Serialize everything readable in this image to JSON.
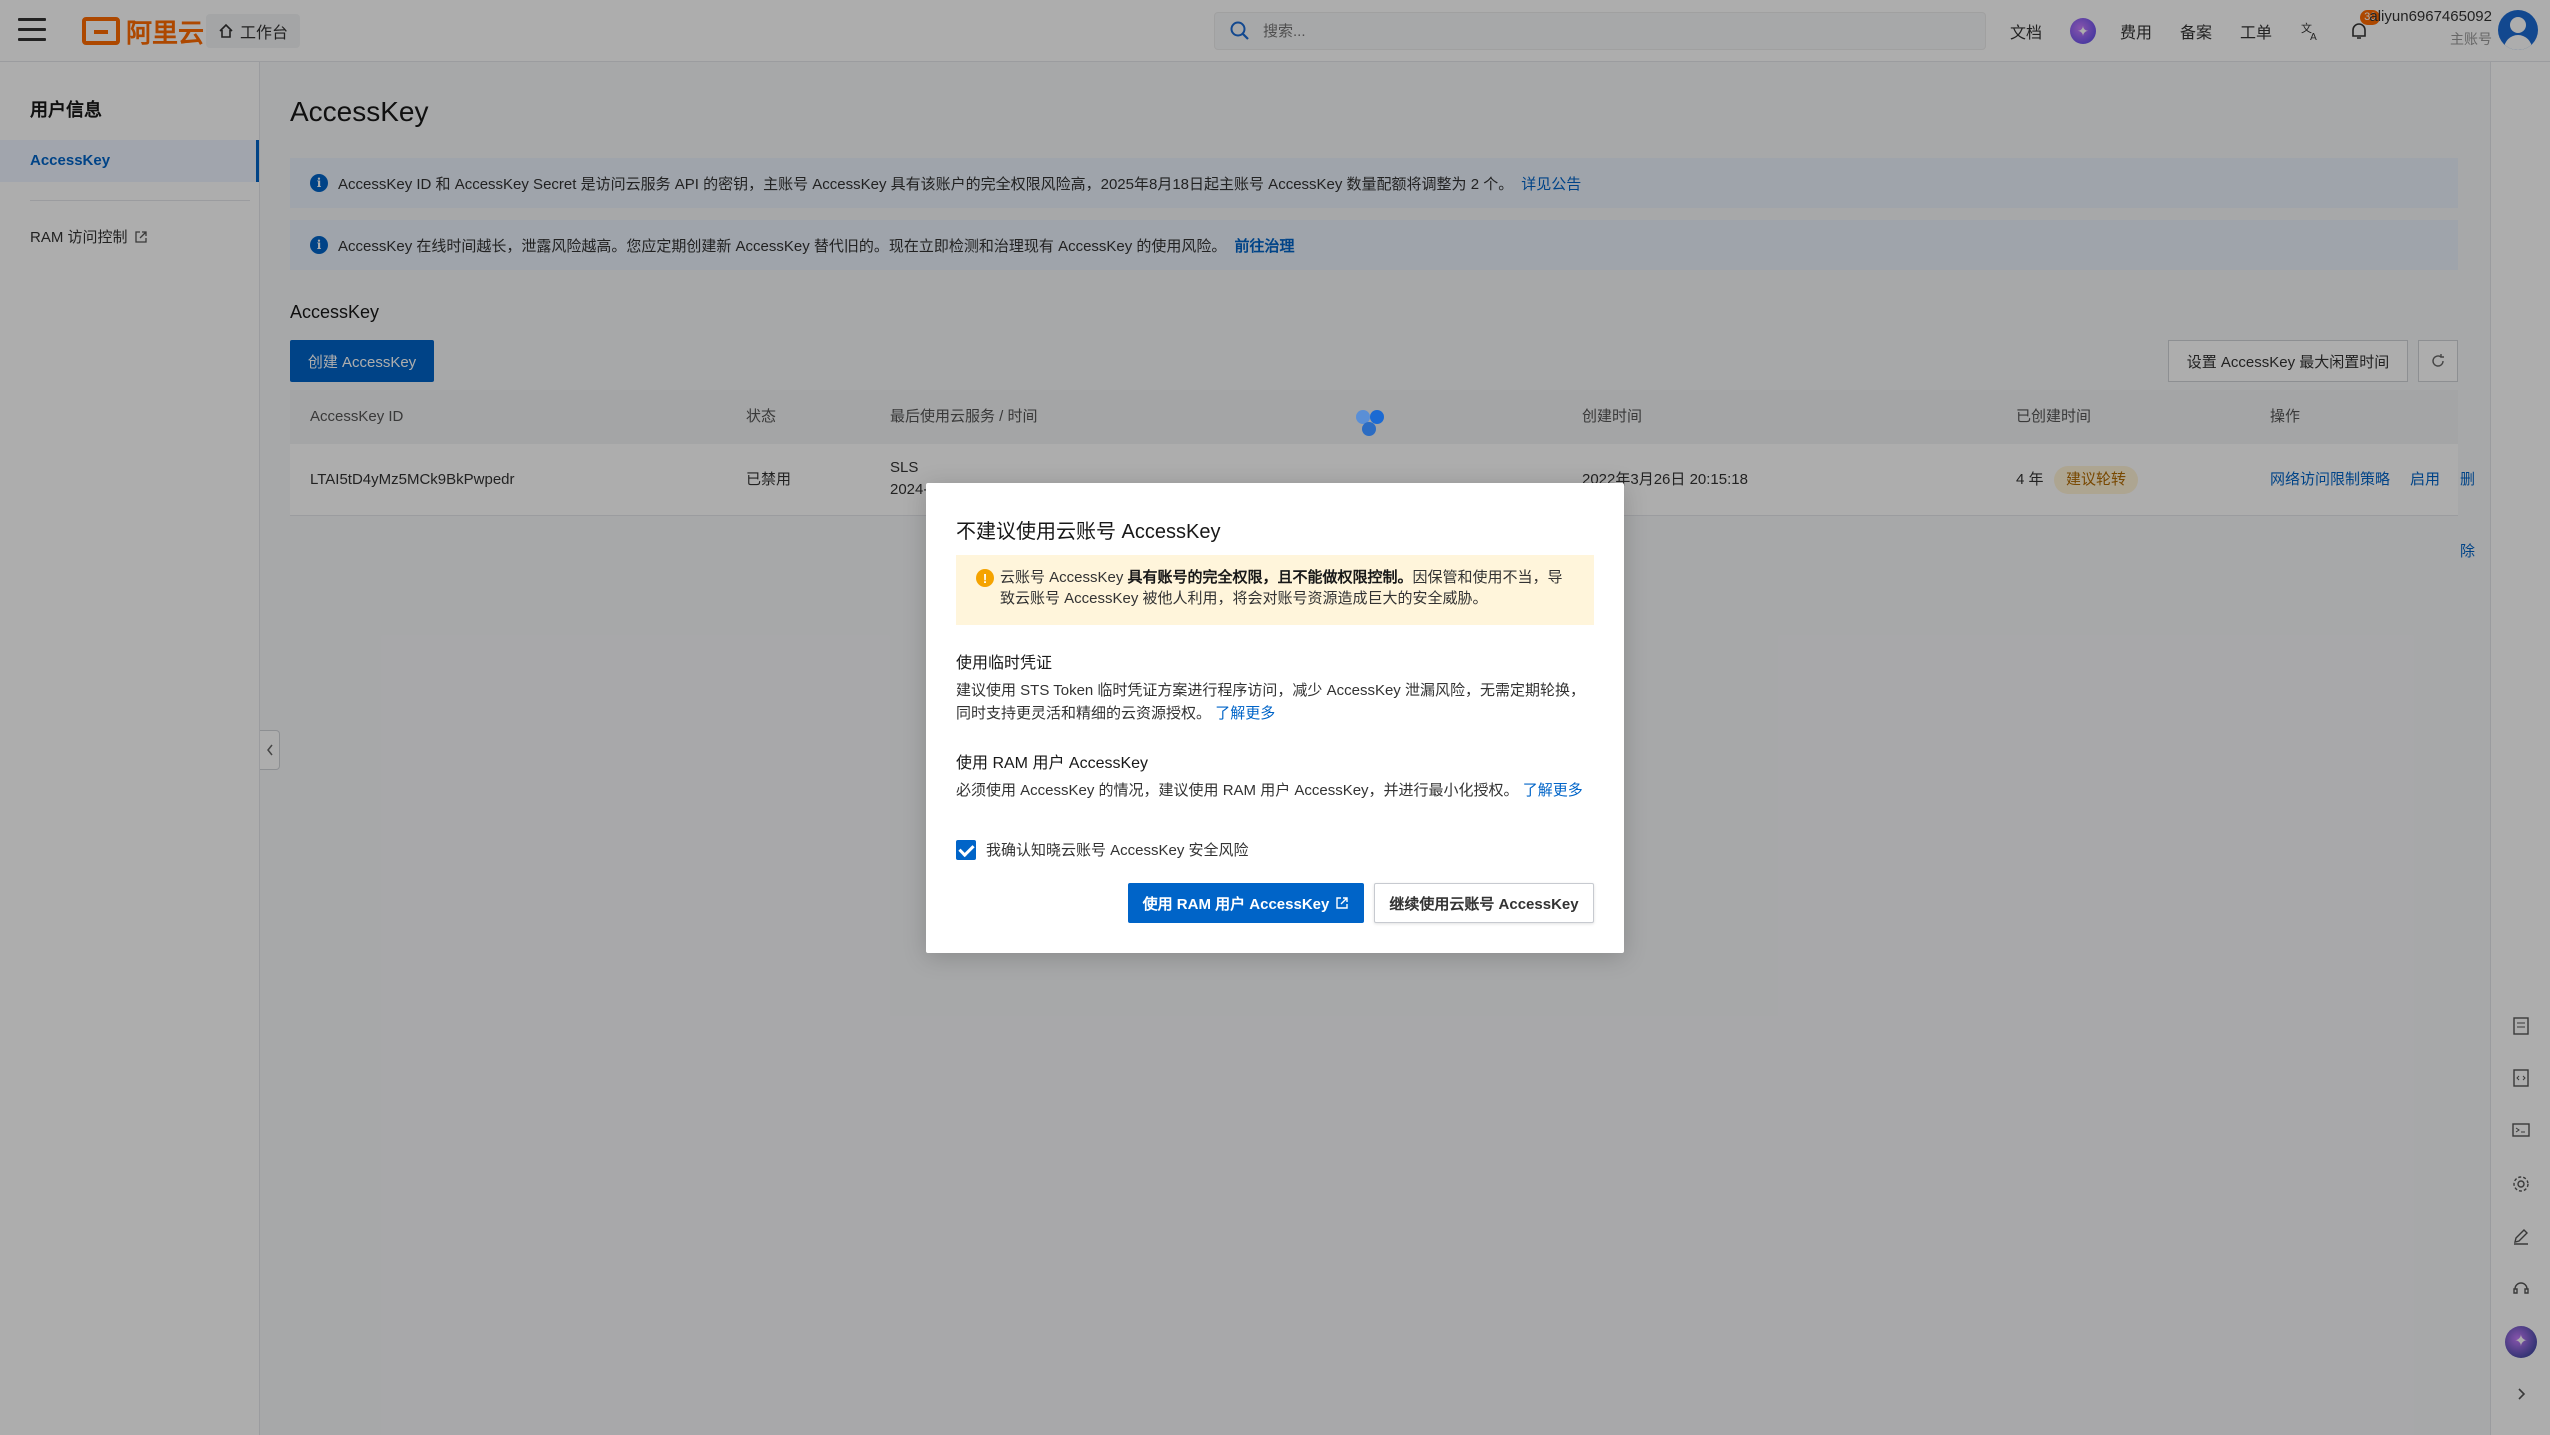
{
  "topbar": {
    "logo_text": "阿里云",
    "workbench_label": "工作台",
    "search_placeholder": "搜索...",
    "links": [
      "文档",
      "费用",
      "备案",
      "工单"
    ],
    "notification_count": "30",
    "account_name": "aliyun6967465092",
    "account_role": "主账号"
  },
  "sidebar": {
    "title": "用户信息",
    "items": [
      {
        "label": "AccessKey"
      },
      {
        "label": "RAM 访问控制"
      }
    ]
  },
  "main": {
    "page_title": "AccessKey",
    "notice1": {
      "text": "AccessKey ID 和 AccessKey Secret 是访问云服务 API 的密钥，主账号 AccessKey 具有该账户的完全权限风险高，2025年8月18日起主账号 AccessKey 数量配额将调整为 2 个。",
      "link": "详见公告"
    },
    "notice2": {
      "text": "AccessKey 在线时间越长，泄露风险越高。您应定期创建新 AccessKey 替代旧的。现在立即检测和治理现有 AccessKey 的使用风险。",
      "link": "前往治理"
    },
    "section_title": "AccessKey",
    "create_button": "创建 AccessKey",
    "max_idle_button": "设置 AccessKey 最大闲置时间",
    "table": {
      "headers": [
        "AccessKey ID",
        "状态",
        "最后使用云服务 / 时间",
        "创建时间",
        "已创建时间",
        "操作"
      ],
      "rows": [
        {
          "id": "LTAI5tD4yMz5MCk9BkPwpedr",
          "status": "已禁用",
          "service": "SLS",
          "service_time": "2024-",
          "created": "2022年3月26日 20:15:18",
          "age": "4 年",
          "badge": "建议轮转",
          "actions": [
            "网络访问限制策略",
            "启用",
            "删除"
          ]
        }
      ]
    }
  },
  "modal": {
    "title": "不建议使用云账号 AccessKey",
    "warning_prefix": "云账号 AccessKey ",
    "warning_bold": "具有账号的完全权限，且不能做权限控制。",
    "warning_suffix": "因保管和使用不当，导致云账号 AccessKey 被他人利用，将会对账号资源造成巨大的安全威胁。",
    "section1_title": "使用临时凭证",
    "section1_text": "建议使用 STS Token 临时凭证方案进行程序访问，减少 AccessKey 泄漏风险，无需定期轮换，同时支持更灵活和精细的云资源授权。",
    "section1_link": "了解更多",
    "section2_title": "使用 RAM 用户 AccessKey",
    "section2_text": "必须使用 AccessKey 的情况，建议使用 RAM 用户 AccessKey，并进行最小化授权。",
    "section2_link": "了解更多",
    "checkbox_label": "我确认知晓云账号 AccessKey 安全风险",
    "checkbox_checked": true,
    "primary_button": "使用 RAM 用户 AccessKey",
    "secondary_button": "继续使用云账号 AccessKey"
  },
  "colors": {
    "brand": "#ff6a00",
    "primary": "#0064c8",
    "warning_bg": "#fff5db"
  }
}
